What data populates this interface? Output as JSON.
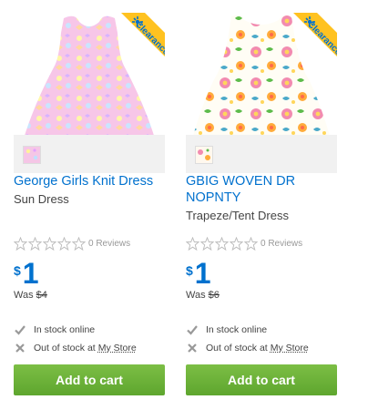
{
  "products": [
    {
      "badge": "Clearance",
      "title": "George Girls Knit Dress",
      "subtitle": "Sun Dress",
      "reviews": "0 Reviews",
      "rating": 0,
      "currency": "$",
      "price": "1",
      "was_label": "Was",
      "was_price": "$4",
      "stock_online": "In stock online",
      "stock_store_prefix": "Out of stock at",
      "stock_store_link": "My Store",
      "cart_label": "Add to cart"
    },
    {
      "badge": "Clearance",
      "title": "GBIG WOVEN DR NOPNTY",
      "subtitle": "Trapeze/Tent Dress",
      "reviews": "0 Reviews",
      "rating": 0,
      "currency": "$",
      "price": "1",
      "was_label": "Was",
      "was_price": "$6",
      "stock_online": "In stock online",
      "stock_store_prefix": "Out of stock at",
      "stock_store_link": "My Store",
      "cart_label": "Add to cart"
    }
  ],
  "colors": {
    "link": "#0071ce",
    "badge": "#ffc220",
    "cart": "#6ab33b"
  },
  "icons": [
    "star-empty-icon",
    "check-icon",
    "x-icon",
    "spark-icon"
  ]
}
